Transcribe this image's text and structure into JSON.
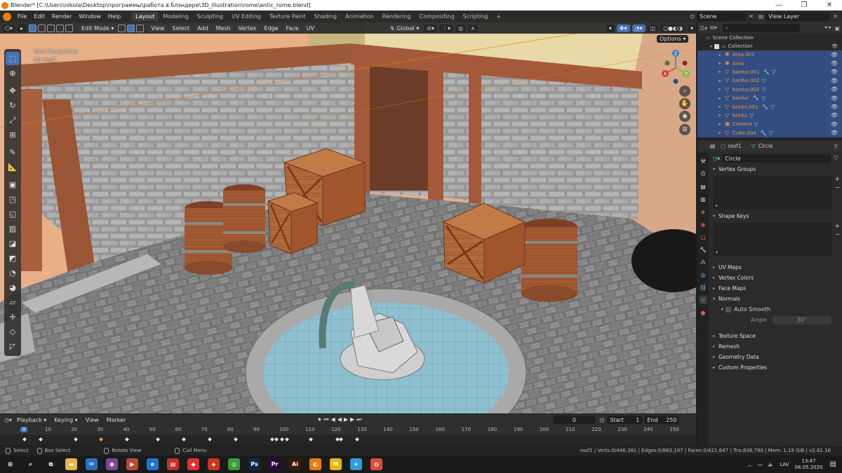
{
  "window": {
    "title": "Blender* [C:\\Users\\nikola\\Desktop\\программы\\работа в блэндере\\3D_illustration\\rome\\antic_rome.blend]",
    "controls": [
      "—",
      "❐",
      "✕"
    ]
  },
  "menu": {
    "items": [
      "File",
      "Edit",
      "Render",
      "Window",
      "Help"
    ],
    "workspaces": [
      "Layout",
      "Modeling",
      "Sculpting",
      "UV Editing",
      "Texture Paint",
      "Shading",
      "Animation",
      "Rendering",
      "Compositing",
      "Scripting"
    ],
    "active_workspace": "Layout",
    "scene": "Scene",
    "view_layer": "View Layer"
  },
  "viewport": {
    "mode": "Edit Mode",
    "menus": [
      "View",
      "Select",
      "Add",
      "Mesh",
      "Vertex",
      "Edge",
      "Face",
      "UV"
    ],
    "orientation": "Global",
    "options_label": "Options",
    "perspective_label": "User Perspective",
    "object_label": "(0) roof1"
  },
  "gizmo": {
    "x": "X",
    "y": "Y",
    "z": "Z"
  },
  "outliner": {
    "root": "Scene Collection",
    "collection": "Collection",
    "items": [
      {
        "name": "Area.001",
        "icon": "light-icon",
        "mod": false
      },
      {
        "name": "Area",
        "icon": "light-icon",
        "mod": false
      },
      {
        "name": "bardur.001",
        "icon": "mesh-icon",
        "mod": true
      },
      {
        "name": "bardur.002",
        "icon": "mesh-icon",
        "mod": false
      },
      {
        "name": "bardur.003",
        "icon": "mesh-icon",
        "mod": false
      },
      {
        "name": "bardur",
        "icon": "mesh-icon",
        "mod": true
      },
      {
        "name": "bricks.001",
        "icon": "mesh-icon",
        "mod": true
      },
      {
        "name": "bricks",
        "icon": "mesh-icon",
        "mod": false
      },
      {
        "name": "Camera",
        "icon": "camera-icon",
        "mod": false
      },
      {
        "name": "Cube.004",
        "icon": "mesh-icon",
        "mod": true
      }
    ]
  },
  "properties": {
    "object": "roof1",
    "mesh": "Circle",
    "data_name": "Circle",
    "panels_top": [
      "Vertex Groups",
      "Shape Keys"
    ],
    "panels_mid": [
      "UV Maps",
      "Vertex Colors",
      "Face Maps",
      "Normals"
    ],
    "auto_smooth": "Auto Smooth",
    "angle_label": "Angle",
    "angle_value": "30°",
    "panels_bottom": [
      "Texture Space",
      "Remesh",
      "Geometry Data",
      "Custom Properties"
    ]
  },
  "timeline": {
    "menus": [
      "Playback",
      "Keying",
      "View",
      "Marker"
    ],
    "current_frame": "0",
    "start_label": "Start",
    "start": "1",
    "end_label": "End",
    "end": "250",
    "ticks": [
      "0",
      "10",
      "20",
      "30",
      "40",
      "50",
      "60",
      "70",
      "80",
      "90",
      "100",
      "110",
      "120",
      "130",
      "140",
      "150",
      "160",
      "170",
      "180",
      "190",
      "200",
      "210",
      "220",
      "230",
      "240",
      "250"
    ]
  },
  "statusbar": {
    "items": [
      "Select",
      "Box Select",
      "Rotate View",
      "Call Menu"
    ],
    "stats": "roof1 | Verts:0/446,381 | Edges:0/863,197 | Faces:0/421,647 | Tris:838,790 | Mem: 1.19 GiB | v2.81.16"
  },
  "taskbar": {
    "lang": "LAV",
    "time": "13:47",
    "date": "08.05.2020",
    "apps": [
      {
        "name": "windows-icon",
        "label": "⊞",
        "color": "#1a1a1a"
      },
      {
        "name": "search-icon",
        "label": "⌕",
        "color": "#1a1a1a"
      },
      {
        "name": "task-view-icon",
        "label": "⧉",
        "color": "#1a1a1a"
      },
      {
        "name": "explorer-icon",
        "label": "▬",
        "color": "#e8b64a"
      },
      {
        "name": "mail-icon",
        "label": "✉",
        "color": "#2b6fc4"
      },
      {
        "name": "tor-icon",
        "label": "◉",
        "color": "#7d4698"
      },
      {
        "name": "media-icon",
        "label": "▶",
        "color": "#b84a3a"
      },
      {
        "name": "edge-icon",
        "label": "e",
        "color": "#1f73c7"
      },
      {
        "name": "pdf-icon",
        "label": "▤",
        "color": "#c42f2f"
      },
      {
        "name": "maps-icon",
        "label": "◆",
        "color": "#d33"
      },
      {
        "name": "vpn-icon",
        "label": "◈",
        "color": "#c32"
      },
      {
        "name": "xbox-icon",
        "label": "◎",
        "color": "#3a9a3a"
      },
      {
        "name": "photoshop-icon",
        "label": "Ps",
        "color": "#0b2a4a"
      },
      {
        "name": "premiere-icon",
        "label": "Pr",
        "color": "#2a0a3a"
      },
      {
        "name": "illustrator-icon",
        "label": "Ai",
        "color": "#3a1a05"
      },
      {
        "name": "blender-icon",
        "label": "◐",
        "color": "#e87d0d"
      },
      {
        "name": "m-app-icon",
        "label": "M",
        "color": "#e8b40d"
      },
      {
        "name": "telegram-icon",
        "label": "➤",
        "color": "#2a9ed8"
      },
      {
        "name": "chrome-icon",
        "label": "◍",
        "color": "#dd4b39"
      }
    ]
  },
  "colors": {
    "accent": "#4772b3",
    "panel": "#2b2b2b",
    "selected_row": "#334d80",
    "object_orange": "#e8994c"
  }
}
